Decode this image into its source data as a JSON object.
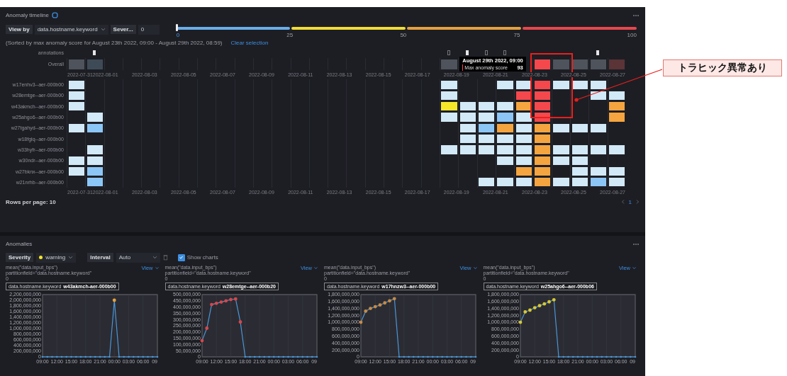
{
  "timeline": {
    "title": "Anomaly timeline",
    "view_by": {
      "label": "View by",
      "value": "data.hostname.keyword"
    },
    "severity": {
      "label": "Sever...",
      "value": "0"
    },
    "severity_slider": {
      "level": 0,
      "segments": [
        {
          "color": "#6aaee8"
        },
        {
          "color": "#f0dc36"
        },
        {
          "color": "#e3a03f"
        },
        {
          "color": "#e5484d"
        }
      ],
      "ticks": [
        "0",
        "25",
        "50",
        "75",
        "100"
      ]
    },
    "sorted_note": "(Sorted by max anomaly score for August 23th 2022, 09:00 - August 29th 2022, 08:59)",
    "clear_selection": "Clear selection",
    "annotations_label": "annotations",
    "annotations": [
      {
        "kind": "none"
      },
      {
        "kind": "filled"
      },
      {
        "kind": "none"
      },
      {
        "kind": "none"
      },
      {
        "kind": "none"
      },
      {
        "kind": "none"
      },
      {
        "kind": "none"
      },
      {
        "kind": "none"
      },
      {
        "kind": "none"
      },
      {
        "kind": "none"
      },
      {
        "kind": "none"
      },
      {
        "kind": "none"
      },
      {
        "kind": "none"
      },
      {
        "kind": "none"
      },
      {
        "kind": "none"
      },
      {
        "kind": "none"
      },
      {
        "kind": "none"
      },
      {
        "kind": "none"
      },
      {
        "kind": "none"
      },
      {
        "kind": "none"
      },
      {
        "kind": "outline"
      },
      {
        "kind": "filled"
      },
      {
        "kind": "outline"
      },
      {
        "kind": "outline"
      },
      {
        "kind": "none"
      },
      {
        "kind": "none"
      },
      {
        "kind": "none"
      },
      {
        "kind": "none"
      },
      {
        "kind": "filled"
      },
      {
        "kind": "none"
      }
    ],
    "overall_label": "Overall",
    "overall": [
      {
        "kind": "gray"
      },
      {
        "kind": "slate"
      },
      {
        "kind": "none"
      },
      {
        "kind": "none"
      },
      {
        "kind": "none"
      },
      {
        "kind": "none"
      },
      {
        "kind": "none"
      },
      {
        "kind": "none"
      },
      {
        "kind": "none"
      },
      {
        "kind": "none"
      },
      {
        "kind": "none"
      },
      {
        "kind": "none"
      },
      {
        "kind": "none"
      },
      {
        "kind": "none"
      },
      {
        "kind": "none"
      },
      {
        "kind": "none"
      },
      {
        "kind": "none"
      },
      {
        "kind": "none"
      },
      {
        "kind": "none"
      },
      {
        "kind": "none"
      },
      {
        "kind": "gray"
      },
      {
        "kind": "none"
      },
      {
        "kind": "none"
      },
      {
        "kind": "none"
      },
      {
        "kind": "none"
      },
      {
        "kind": "critical"
      },
      {
        "kind": "gray"
      },
      {
        "kind": "gray"
      },
      {
        "kind": "gray"
      },
      {
        "kind": "dim"
      }
    ],
    "tooltip": {
      "title": "August 29th 2022, 09:00",
      "label": "Max anomaly score",
      "value": "93"
    },
    "axis_top": [
      "2022-07-312022-08-01",
      "2022-08-03",
      "2022-08-05",
      "2022-08-07",
      "2022-08-09",
      "2022-08-11",
      "2022-08-13",
      "2022-08-15",
      "2022-08-17",
      "2022-08-19",
      "2022-08-21",
      "2022-08-23",
      "2022-08-25",
      "2022-08-27"
    ],
    "rows": [
      {
        "label": "w17enhv3--aer-000b00",
        "cells": [
          {
            "kind": "low"
          },
          {
            "kind": "none"
          },
          {
            "kind": "none"
          },
          {
            "kind": "none"
          },
          {
            "kind": "none"
          },
          {
            "kind": "none"
          },
          {
            "kind": "none"
          },
          {
            "kind": "none"
          },
          {
            "kind": "none"
          },
          {
            "kind": "none"
          },
          {
            "kind": "none"
          },
          {
            "kind": "none"
          },
          {
            "kind": "none"
          },
          {
            "kind": "none"
          },
          {
            "kind": "none"
          },
          {
            "kind": "none"
          },
          {
            "kind": "none"
          },
          {
            "kind": "none"
          },
          {
            "kind": "none"
          },
          {
            "kind": "none"
          },
          {
            "kind": "low"
          },
          {
            "kind": "none"
          },
          {
            "kind": "none"
          },
          {
            "kind": "low"
          },
          {
            "kind": "low"
          },
          {
            "kind": "critical"
          },
          {
            "kind": "low"
          },
          {
            "kind": "low"
          },
          {
            "kind": "low"
          },
          {
            "kind": "none"
          }
        ]
      },
      {
        "label": "w28emtge--aer-000b00",
        "cells": [
          {
            "kind": "low"
          },
          {
            "kind": "none"
          },
          {
            "kind": "none"
          },
          {
            "kind": "none"
          },
          {
            "kind": "none"
          },
          {
            "kind": "none"
          },
          {
            "kind": "none"
          },
          {
            "kind": "none"
          },
          {
            "kind": "none"
          },
          {
            "kind": "none"
          },
          {
            "kind": "none"
          },
          {
            "kind": "none"
          },
          {
            "kind": "none"
          },
          {
            "kind": "none"
          },
          {
            "kind": "none"
          },
          {
            "kind": "none"
          },
          {
            "kind": "none"
          },
          {
            "kind": "none"
          },
          {
            "kind": "none"
          },
          {
            "kind": "none"
          },
          {
            "kind": "low"
          },
          {
            "kind": "none"
          },
          {
            "kind": "none"
          },
          {
            "kind": "none"
          },
          {
            "kind": "critical"
          },
          {
            "kind": "critical"
          },
          {
            "kind": "none"
          },
          {
            "kind": "none"
          },
          {
            "kind": "low"
          },
          {
            "kind": "low"
          }
        ]
      },
      {
        "label": "w43akmch--aer-000b00",
        "cells": [
          {
            "kind": "low"
          },
          {
            "kind": "none"
          },
          {
            "kind": "none"
          },
          {
            "kind": "none"
          },
          {
            "kind": "none"
          },
          {
            "kind": "none"
          },
          {
            "kind": "none"
          },
          {
            "kind": "none"
          },
          {
            "kind": "none"
          },
          {
            "kind": "none"
          },
          {
            "kind": "none"
          },
          {
            "kind": "none"
          },
          {
            "kind": "none"
          },
          {
            "kind": "none"
          },
          {
            "kind": "none"
          },
          {
            "kind": "none"
          },
          {
            "kind": "none"
          },
          {
            "kind": "none"
          },
          {
            "kind": "none"
          },
          {
            "kind": "none"
          },
          {
            "kind": "warning"
          },
          {
            "kind": "low"
          },
          {
            "kind": "low"
          },
          {
            "kind": "low"
          },
          {
            "kind": "major"
          },
          {
            "kind": "critical"
          },
          {
            "kind": "none"
          },
          {
            "kind": "none"
          },
          {
            "kind": "none"
          },
          {
            "kind": "major"
          }
        ]
      },
      {
        "label": "w25ahgo6--aer-000b00",
        "cells": [
          {
            "kind": "none"
          },
          {
            "kind": "low"
          },
          {
            "kind": "none"
          },
          {
            "kind": "none"
          },
          {
            "kind": "none"
          },
          {
            "kind": "none"
          },
          {
            "kind": "none"
          },
          {
            "kind": "none"
          },
          {
            "kind": "none"
          },
          {
            "kind": "none"
          },
          {
            "kind": "none"
          },
          {
            "kind": "none"
          },
          {
            "kind": "none"
          },
          {
            "kind": "none"
          },
          {
            "kind": "none"
          },
          {
            "kind": "none"
          },
          {
            "kind": "none"
          },
          {
            "kind": "none"
          },
          {
            "kind": "none"
          },
          {
            "kind": "none"
          },
          {
            "kind": "low"
          },
          {
            "kind": "low"
          },
          {
            "kind": "low"
          },
          {
            "kind": "minor"
          },
          {
            "kind": "low"
          },
          {
            "kind": "critical"
          },
          {
            "kind": "none"
          },
          {
            "kind": "none"
          },
          {
            "kind": "none"
          },
          {
            "kind": "major"
          }
        ]
      },
      {
        "label": "w27tgahyd--aer-000b00",
        "cells": [
          {
            "kind": "low"
          },
          {
            "kind": "minor"
          },
          {
            "kind": "none"
          },
          {
            "kind": "none"
          },
          {
            "kind": "none"
          },
          {
            "kind": "none"
          },
          {
            "kind": "none"
          },
          {
            "kind": "none"
          },
          {
            "kind": "none"
          },
          {
            "kind": "none"
          },
          {
            "kind": "none"
          },
          {
            "kind": "none"
          },
          {
            "kind": "none"
          },
          {
            "kind": "none"
          },
          {
            "kind": "none"
          },
          {
            "kind": "none"
          },
          {
            "kind": "none"
          },
          {
            "kind": "none"
          },
          {
            "kind": "none"
          },
          {
            "kind": "none"
          },
          {
            "kind": "none"
          },
          {
            "kind": "low"
          },
          {
            "kind": "minor"
          },
          {
            "kind": "major"
          },
          {
            "kind": "low"
          },
          {
            "kind": "major"
          },
          {
            "kind": "low"
          },
          {
            "kind": "low"
          },
          {
            "kind": "low"
          },
          {
            "kind": "none"
          }
        ]
      },
      {
        "label": "w18fglq--aer-000b00",
        "cells": [
          {
            "kind": "none"
          },
          {
            "kind": "none"
          },
          {
            "kind": "none"
          },
          {
            "kind": "none"
          },
          {
            "kind": "none"
          },
          {
            "kind": "none"
          },
          {
            "kind": "none"
          },
          {
            "kind": "none"
          },
          {
            "kind": "none"
          },
          {
            "kind": "none"
          },
          {
            "kind": "none"
          },
          {
            "kind": "none"
          },
          {
            "kind": "none"
          },
          {
            "kind": "none"
          },
          {
            "kind": "none"
          },
          {
            "kind": "none"
          },
          {
            "kind": "none"
          },
          {
            "kind": "none"
          },
          {
            "kind": "none"
          },
          {
            "kind": "none"
          },
          {
            "kind": "none"
          },
          {
            "kind": "low"
          },
          {
            "kind": "low"
          },
          {
            "kind": "low"
          },
          {
            "kind": "low"
          },
          {
            "kind": "major"
          },
          {
            "kind": "none"
          },
          {
            "kind": "none"
          },
          {
            "kind": "none"
          },
          {
            "kind": "none"
          }
        ]
      },
      {
        "label": "w33hyfr--aer-000b00",
        "cells": [
          {
            "kind": "none"
          },
          {
            "kind": "low"
          },
          {
            "kind": "none"
          },
          {
            "kind": "none"
          },
          {
            "kind": "none"
          },
          {
            "kind": "none"
          },
          {
            "kind": "none"
          },
          {
            "kind": "none"
          },
          {
            "kind": "none"
          },
          {
            "kind": "none"
          },
          {
            "kind": "none"
          },
          {
            "kind": "none"
          },
          {
            "kind": "none"
          },
          {
            "kind": "none"
          },
          {
            "kind": "none"
          },
          {
            "kind": "none"
          },
          {
            "kind": "none"
          },
          {
            "kind": "none"
          },
          {
            "kind": "none"
          },
          {
            "kind": "none"
          },
          {
            "kind": "low"
          },
          {
            "kind": "low"
          },
          {
            "kind": "low"
          },
          {
            "kind": "low"
          },
          {
            "kind": "low"
          },
          {
            "kind": "major"
          },
          {
            "kind": "low"
          },
          {
            "kind": "low"
          },
          {
            "kind": "low"
          },
          {
            "kind": "low"
          }
        ]
      },
      {
        "label": "w30ndr--aer-000b00",
        "cells": [
          {
            "kind": "low"
          },
          {
            "kind": "low"
          },
          {
            "kind": "none"
          },
          {
            "kind": "none"
          },
          {
            "kind": "none"
          },
          {
            "kind": "none"
          },
          {
            "kind": "none"
          },
          {
            "kind": "none"
          },
          {
            "kind": "none"
          },
          {
            "kind": "none"
          },
          {
            "kind": "none"
          },
          {
            "kind": "none"
          },
          {
            "kind": "none"
          },
          {
            "kind": "none"
          },
          {
            "kind": "none"
          },
          {
            "kind": "none"
          },
          {
            "kind": "none"
          },
          {
            "kind": "none"
          },
          {
            "kind": "none"
          },
          {
            "kind": "none"
          },
          {
            "kind": "none"
          },
          {
            "kind": "none"
          },
          {
            "kind": "none"
          },
          {
            "kind": "low"
          },
          {
            "kind": "low"
          },
          {
            "kind": "major"
          },
          {
            "kind": "low"
          },
          {
            "kind": "low"
          },
          {
            "kind": "none"
          },
          {
            "kind": "none"
          }
        ]
      },
      {
        "label": "w27bknx--aer-000b00",
        "cells": [
          {
            "kind": "low"
          },
          {
            "kind": "minor"
          },
          {
            "kind": "none"
          },
          {
            "kind": "none"
          },
          {
            "kind": "none"
          },
          {
            "kind": "none"
          },
          {
            "kind": "none"
          },
          {
            "kind": "none"
          },
          {
            "kind": "none"
          },
          {
            "kind": "none"
          },
          {
            "kind": "none"
          },
          {
            "kind": "none"
          },
          {
            "kind": "none"
          },
          {
            "kind": "none"
          },
          {
            "kind": "none"
          },
          {
            "kind": "none"
          },
          {
            "kind": "none"
          },
          {
            "kind": "none"
          },
          {
            "kind": "none"
          },
          {
            "kind": "none"
          },
          {
            "kind": "none"
          },
          {
            "kind": "none"
          },
          {
            "kind": "none"
          },
          {
            "kind": "none"
          },
          {
            "kind": "major"
          },
          {
            "kind": "major"
          },
          {
            "kind": "none"
          },
          {
            "kind": "low"
          },
          {
            "kind": "low"
          },
          {
            "kind": "low"
          }
        ]
      },
      {
        "label": "w21nrhb--aer-000b00",
        "cells": [
          {
            "kind": "none"
          },
          {
            "kind": "minor"
          },
          {
            "kind": "none"
          },
          {
            "kind": "none"
          },
          {
            "kind": "none"
          },
          {
            "kind": "none"
          },
          {
            "kind": "none"
          },
          {
            "kind": "none"
          },
          {
            "kind": "none"
          },
          {
            "kind": "none"
          },
          {
            "kind": "none"
          },
          {
            "kind": "none"
          },
          {
            "kind": "none"
          },
          {
            "kind": "none"
          },
          {
            "kind": "none"
          },
          {
            "kind": "none"
          },
          {
            "kind": "none"
          },
          {
            "kind": "none"
          },
          {
            "kind": "none"
          },
          {
            "kind": "none"
          },
          {
            "kind": "none"
          },
          {
            "kind": "none"
          },
          {
            "kind": "low"
          },
          {
            "kind": "low"
          },
          {
            "kind": "low"
          },
          {
            "kind": "major"
          },
          {
            "kind": "low"
          },
          {
            "kind": "low"
          },
          {
            "kind": "minor"
          },
          {
            "kind": "low"
          }
        ]
      }
    ],
    "axis_bottom": [
      "2022-07-312022-08-01",
      "2022-08-03",
      "2022-08-05",
      "2022-08-07",
      "2022-08-09",
      "2022-08-11",
      "2022-08-13",
      "2022-08-15",
      "2022-08-17",
      "2022-08-19",
      "2022-08-21",
      "2022-08-23",
      "2022-08-25",
      "2022-08-27"
    ],
    "rows_per_page": "Rows per page: 10",
    "page": "1"
  },
  "anomalies": {
    "title": "Anomalies",
    "severity": {
      "label": "Severity",
      "value": "warning"
    },
    "interval": {
      "label": "Interval",
      "value": "Auto"
    },
    "show_charts": {
      "label": "Show charts",
      "checked": true
    },
    "charts": [
      {
        "title": "mean(\"data.input_bps\") partitionfield=\"data.hostname.keyword\"",
        "subtitle": "0",
        "view": "View",
        "entity_field": "data.hostname.keyword",
        "entity_value": "w43akmch-aer-000b00",
        "color": "#e8a23a",
        "chart_data": {
          "type": "line",
          "categories": [
            "09:00",
            null,
            null,
            "12:00",
            null,
            null,
            "15:00",
            null,
            null,
            "18:00",
            null,
            null,
            "21:00",
            null,
            null,
            "00:00",
            null,
            null,
            "03:00",
            null,
            null,
            "06:00",
            null,
            null,
            "09"
          ],
          "ylim": [
            0,
            2200000000
          ],
          "yticks": [
            {
              "value": 0,
              "label": "0"
            },
            {
              "value": 200000000,
              "label": "200,000,000"
            },
            {
              "value": 400000000,
              "label": "400,000,000"
            },
            {
              "value": 600000000,
              "label": "600,000,000"
            },
            {
              "value": 800000000,
              "label": "800,000,000"
            },
            {
              "value": 1000000000,
              "label": "1,000,000,000"
            },
            {
              "value": 1200000000,
              "label": "1,200,000,000"
            },
            {
              "value": 1400000000,
              "label": "1,400,000,000"
            },
            {
              "value": 1600000000,
              "label": "1,600,000,000"
            },
            {
              "value": 1800000000,
              "label": "1,800,000,000"
            },
            {
              "value": 2000000000,
              "label": "2,000,000,000"
            },
            {
              "value": 2200000000,
              "label": "2,200,000,000"
            }
          ],
          "grid": true,
          "series": [
            {
              "color": "#4a96d8",
              "values": [
                0,
                0,
                0,
                0,
                0,
                0,
                0,
                0,
                0,
                0,
                0,
                0,
                0,
                0,
                0,
                2000000000,
                0,
                0,
                0,
                0,
                0,
                0,
                0,
                0,
                0
              ]
            }
          ]
        }
      },
      {
        "title": "mean(\"data.input_bps\") partitionfield=\"data.hostname.keyword\"",
        "subtitle": "0",
        "view": "View",
        "entity_field": "data.hostname.keyword",
        "entity_value": "w28emtge--aer-000b20",
        "color": "#d9464a",
        "chart_data": {
          "type": "line",
          "categories": [
            "09:00",
            null,
            null,
            "12:00",
            null,
            null,
            "15:00",
            null,
            null,
            "18:00",
            null,
            null,
            "21:00",
            null,
            null,
            "00:00",
            null,
            null,
            "03:00",
            null,
            null,
            "06:00",
            null,
            null,
            "09"
          ],
          "ylim": [
            0,
            500000000
          ],
          "yticks": [
            {
              "value": 0,
              "label": "0"
            },
            {
              "value": 50000000,
              "label": "50,000,000"
            },
            {
              "value": 100000000,
              "label": "100,000,000"
            },
            {
              "value": 150000000,
              "label": "150,000,000"
            },
            {
              "value": 200000000,
              "label": "200,000,000"
            },
            {
              "value": 250000000,
              "label": "250,000,000"
            },
            {
              "value": 300000000,
              "label": "300,000,000"
            },
            {
              "value": 350000000,
              "label": "350,000,000"
            },
            {
              "value": 400000000,
              "label": "400,000,000"
            },
            {
              "value": 450000000,
              "label": "450,000,000"
            },
            {
              "value": 500000000,
              "label": "500,000,000"
            }
          ],
          "grid": true,
          "series": [
            {
              "color": "#4a96d8",
              "values": [
                130000000,
                230000000,
                420000000,
                430000000,
                440000000,
                450000000,
                460000000,
                465000000,
                280000000,
                0,
                0,
                0,
                0,
                0,
                0,
                0,
                0,
                0,
                0,
                0,
                0,
                0,
                0,
                0,
                0
              ]
            }
          ]
        }
      },
      {
        "title": "mean(\"data.input_bps\") partitionfield=\"data.hostname.keyword\"",
        "subtitle": "0",
        "view": "View",
        "entity_field": "data.hostname.keyword",
        "entity_value": "w17hnzw3--aer-000b00",
        "color": "#c98a45",
        "chart_data": {
          "type": "line",
          "categories": [
            "09:00",
            null,
            null,
            "12:00",
            null,
            null,
            "15:00",
            null,
            null,
            "18:00",
            null,
            null,
            "21:00",
            null,
            null,
            "00:00",
            null,
            null,
            "03:00",
            null,
            null,
            "06:00",
            null,
            null,
            "09"
          ],
          "ylim": [
            0,
            1800000000
          ],
          "yticks": [
            {
              "value": 0,
              "label": "0"
            },
            {
              "value": 200000000,
              "label": "200,000,000"
            },
            {
              "value": 400000000,
              "label": "400,000,000"
            },
            {
              "value": 600000000,
              "label": "600,000,000"
            },
            {
              "value": 800000000,
              "label": "800,000,000"
            },
            {
              "value": 1000000000,
              "label": "1,000,000,000"
            },
            {
              "value": 1200000000,
              "label": "1,200,000,000"
            },
            {
              "value": 1400000000,
              "label": "1,400,000,000"
            },
            {
              "value": 1600000000,
              "label": "1,600,000,000"
            },
            {
              "value": 1800000000,
              "label": "1,800,000,000"
            }
          ],
          "grid": true,
          "series": [
            {
              "color": "#4a96d8",
              "values": [
                1000000000,
                1320000000,
                1400000000,
                1450000000,
                1500000000,
                1560000000,
                1620000000,
                1680000000,
                0,
                0,
                0,
                0,
                0,
                0,
                0,
                0,
                0,
                0,
                0,
                0,
                0,
                0,
                0,
                0,
                0
              ]
            }
          ]
        }
      },
      {
        "title": "mean(\"data.input_bps\") partitionfield=\"data.hostname.keyword\"",
        "subtitle": "0",
        "view": "View",
        "entity_field": "data.hostname.keyword",
        "entity_value": "w25ahgo6--aer-000b06",
        "color": "#d8c832",
        "chart_data": {
          "type": "line",
          "categories": [
            "09:00",
            null,
            null,
            "12:00",
            null,
            null,
            "15:00",
            null,
            null,
            "18:00",
            null,
            null,
            "21:00",
            null,
            null,
            "00:00",
            null,
            null,
            "03:00",
            null,
            null,
            "06:00",
            null,
            null,
            "09"
          ],
          "ylim": [
            0,
            1800000000
          ],
          "yticks": [
            {
              "value": 0,
              "label": "0"
            },
            {
              "value": 200000000,
              "label": "200,000,000"
            },
            {
              "value": 400000000,
              "label": "400,000,000"
            },
            {
              "value": 600000000,
              "label": "600,000,000"
            },
            {
              "value": 800000000,
              "label": "800,000,000"
            },
            {
              "value": 1000000000,
              "label": "1,000,000,000"
            },
            {
              "value": 1200000000,
              "label": "1,200,000,000"
            },
            {
              "value": 1400000000,
              "label": "1,400,000,000"
            },
            {
              "value": 1600000000,
              "label": "1,600,000,000"
            },
            {
              "value": 1800000000,
              "label": "1,800,000,000"
            }
          ],
          "grid": true,
          "series": [
            {
              "color": "#4a96d8",
              "values": [
                1000000000,
                1300000000,
                1350000000,
                1420000000,
                1480000000,
                1530000000,
                1590000000,
                1650000000,
                0,
                0,
                0,
                0,
                0,
                0,
                0,
                0,
                0,
                0,
                0,
                0,
                0,
                0,
                0,
                0,
                0
              ]
            }
          ]
        }
      }
    ]
  },
  "callout": {
    "text": "トラヒック異常あり"
  }
}
